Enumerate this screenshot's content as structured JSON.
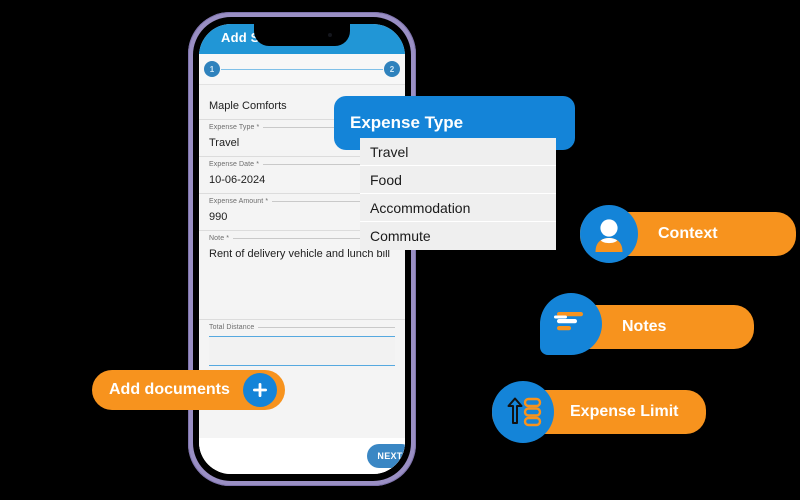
{
  "app": {
    "header_title": "Add SP Expense",
    "stepper": {
      "step1": "1",
      "step2": "2"
    },
    "next_label": "NEXT"
  },
  "form": {
    "fields": [
      {
        "label": "",
        "value": "Maple Comforts"
      },
      {
        "label": "Expense Type *",
        "value": "Travel"
      },
      {
        "label": "Expense Date *",
        "value": "10-06-2024"
      },
      {
        "label": "Expense Amount *",
        "value": "990"
      },
      {
        "label": "Note *",
        "value": "Rent of delivery vehicle and lunch bill"
      }
    ],
    "distance_label": "Total Distance",
    "distance_value": ""
  },
  "dropdown": {
    "title": "Expense Type",
    "options": [
      "Travel",
      "Food",
      "Accommodation",
      "Commute"
    ]
  },
  "badges": {
    "context": {
      "label": "Context",
      "icon": "person-icon"
    },
    "notes": {
      "label": "Notes",
      "icon": "speech-bubble-icon"
    },
    "limit": {
      "label": "Expense Limit",
      "icon": "arrow-up-list-icon"
    },
    "add_documents": {
      "label": "Add documents",
      "icon": "plus-icon"
    }
  },
  "colors": {
    "brand_blue": "#1484d8",
    "appbar_blue": "#2196d6",
    "accent_orange": "#f7931e",
    "frame_purple": "#9a8fc4",
    "background": "#000000"
  }
}
